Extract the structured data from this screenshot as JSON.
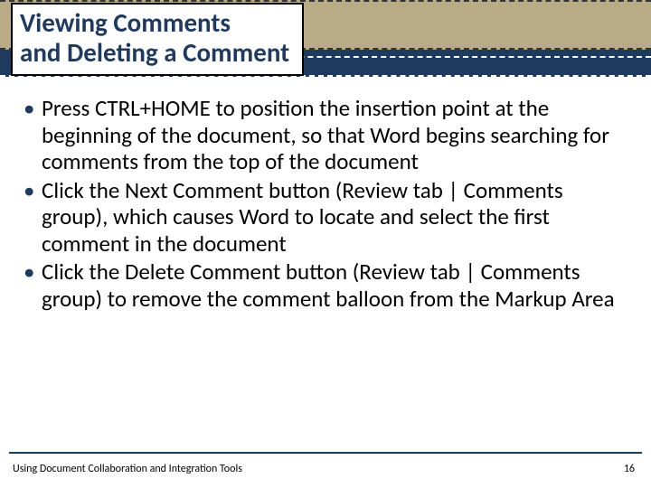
{
  "title": {
    "line1": "Viewing Comments",
    "line2": "and Deleting a Comment"
  },
  "bullets": [
    "Press CTRL+HOME to position the insertion point at the beginning of the document, so that Word begins searching for comments from the top of the document",
    "Click the Next Comment button (Review tab | Comments group), which causes Word to locate and select the first comment in the document",
    "Click the Delete Comment button (Review tab | Comments group) to remove the comment balloon from the Markup Area"
  ],
  "footer": {
    "left": "Using Document Collaboration and Integration Tools",
    "right": "16"
  }
}
